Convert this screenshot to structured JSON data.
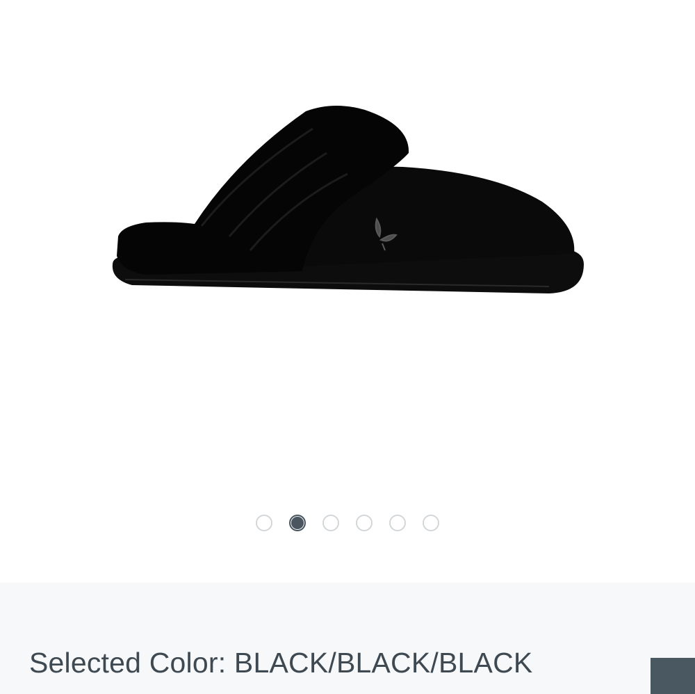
{
  "gallery": {
    "image_alt": "black suede slipper with black faux fur collar",
    "slide_count": 6,
    "active_slide": 2
  },
  "color_selector": {
    "label": "Selected Color:",
    "value": "BLACK/BLACK/BLACK",
    "swatch_color": "#4a5862"
  },
  "colors": {
    "dot_active": "#4a5560",
    "dot_inactive_border": "#d3d7da",
    "panel_bg": "#f6f8f9",
    "text": "#3f4952"
  }
}
